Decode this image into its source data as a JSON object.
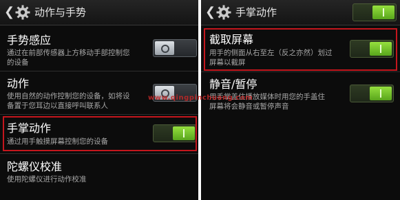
{
  "left": {
    "header_title": "动作与手势",
    "items": [
      {
        "title": "手势感应",
        "desc": [
          "通过在前部传感器上方移动手部控制您",
          "的设备"
        ],
        "toggle": "off"
      },
      {
        "title": "动作",
        "desc": [
          "使用自然的动作控制您的设备，如将设",
          "备置于您耳边以直接呼叫联系人"
        ],
        "toggle": "off"
      },
      {
        "title": "手掌动作",
        "desc": [
          "通过用手触摸屏幕控制您的设备"
        ],
        "toggle": "on"
      },
      {
        "title": "陀螺仪校准",
        "desc": [
          "使用陀螺仪进行动作校准"
        ]
      }
    ]
  },
  "right": {
    "header_title": "手掌动作",
    "header_toggle": "on",
    "items": [
      {
        "title": "截取屏幕",
        "desc": [
          "用手的侧面从右至左（反之亦然）划过",
          "屏幕以截屏"
        ],
        "toggle": "on"
      },
      {
        "title": "静音/暂停",
        "desc": [
          "用手掌盖住播放媒体时用您的手盖住",
          "屏幕将会静音或暂停声音"
        ],
        "toggle": "on"
      }
    ]
  },
  "watermark": "www.qingpinchuang.com",
  "colors": {
    "background": "#0c0c0c",
    "highlight": "#c5161d",
    "toggle_on": "#6fc02a",
    "toggle_off": "#3c4044"
  },
  "icons": [
    "back-arrow-icon",
    "gear-icon"
  ]
}
